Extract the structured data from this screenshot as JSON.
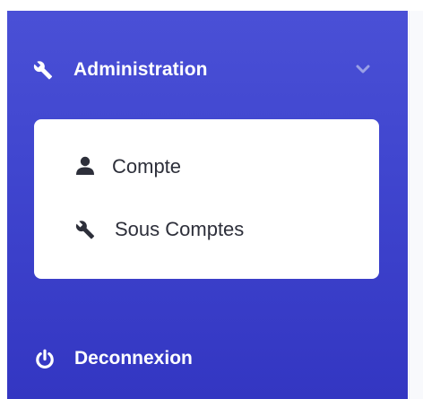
{
  "sidebar": {
    "section": {
      "label": "Administration",
      "icon": "wrench-icon",
      "expanded_indicator": "chevron-down-icon"
    },
    "submenu": {
      "items": [
        {
          "label": "Compte",
          "icon": "user-icon"
        },
        {
          "label": "Sous Comptes",
          "icon": "wrench-icon"
        }
      ]
    },
    "logout": {
      "label": "Deconnexion",
      "icon": "power-icon"
    }
  },
  "colors": {
    "sidebar_background": "#4046cf",
    "submenu_background": "#ffffff",
    "text_on_sidebar": "#ffffff",
    "submenu_text": "#2d2f3a",
    "chevron": "#9aa0e6"
  }
}
